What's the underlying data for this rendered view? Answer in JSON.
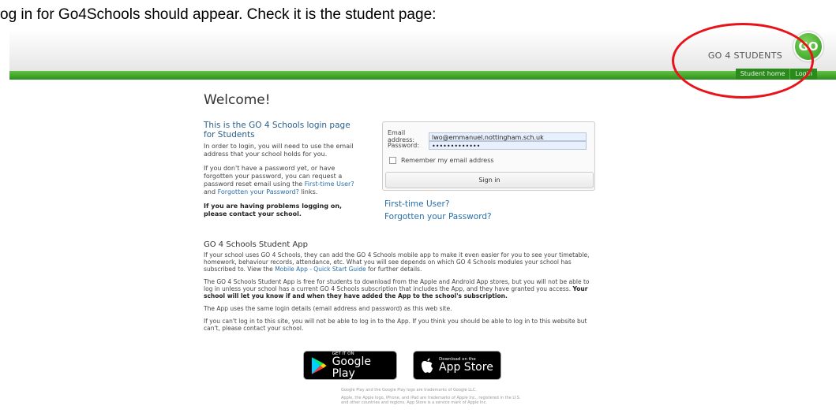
{
  "caption": "og in for Go4Schools should appear. Check it is the student page:",
  "header": {
    "brand": "GO 4 STUDENTS",
    "logo": "GO",
    "nav": [
      "Student home",
      "Login"
    ]
  },
  "main": {
    "welcome": "Welcome!",
    "intro_heading": "This is the GO 4 Schools login page for Students",
    "intro_p1": "In order to login, you will need to use the email address that your school holds for you.",
    "intro_p2_pre": "If you don't have a password yet, or have forgotten your password, you can request a password reset email using the ",
    "intro_p2_link1": "First-time User?",
    "intro_p2_mid": " and ",
    "intro_p2_link2": "Forgotten your Password?",
    "intro_p2_post": " links.",
    "intro_p3": "If you are having problems logging on, please contact your school."
  },
  "login": {
    "email_label": "Email address:",
    "email_value": "lwo@emmanuel.nottingham.sch.uk",
    "password_label": "Password:",
    "password_value": "•••••••••••••",
    "remember_label": "Remember my email address",
    "signin_label": "Sign in",
    "first_time": "First-time User?",
    "forgotten": "Forgotten your Password?"
  },
  "app": {
    "heading": "GO 4 Schools Student App",
    "p1_pre": "If your school uses GO 4 Schools, they can add the GO 4 Schools mobile app to make it even easier for you to see your timetable, homework, behaviour records, attendance, etc. What you will see depends on which GO 4 Schools modules your school has subscribed to. View the ",
    "p1_link": "Mobile App - Quick Start Guide",
    "p1_post": " for further details.",
    "p2_pre": "The GO 4 Schools Student App is free for students to download from the Apple and Android App stores, but you will not be able to log in unless your school has a current GO 4 Schools subscription that includes the App, and they have granted you access. ",
    "p2_bold": "Your school will let you know if and when they have added the App to the school's subscription.",
    "p3": "The App uses the same login details (email address and password) as this web site.",
    "p4": "If you can't log in to this site, you will not be able to log in to the App. If you think you should be able to log in to this website but can't, please contact your school."
  },
  "badges": {
    "google_small": "GET IT ON",
    "google_big": "Google Play",
    "apple_small": "Download on the",
    "apple_big": "App Store"
  },
  "footer": {
    "note1": "Google Play and the Google Play logo are trademarks of Google LLC.",
    "note2": "Apple, the Apple logo, iPhone, and iPad are trademarks of Apple Inc., registered in the U.S. and other countries and regions. App Store is a service mark of Apple Inc."
  },
  "colors": {
    "accent_green": "#2d8f1d",
    "highlight_ring": "#e8121b",
    "link": "#2a6ea8"
  }
}
